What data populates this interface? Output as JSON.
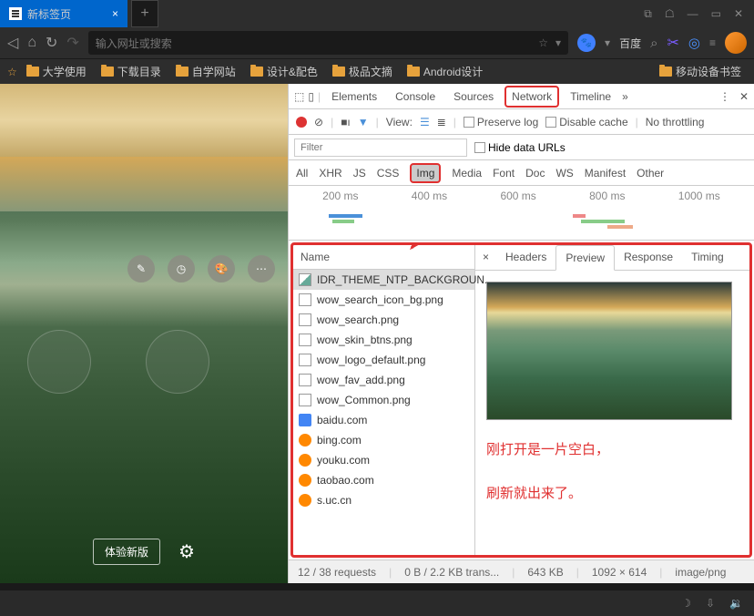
{
  "titlebar": {
    "tab_title": "新标签页",
    "newtab": "+"
  },
  "nav": {
    "placeholder": "输入网址或搜索",
    "search_engine": "百度"
  },
  "bookmarks": {
    "items": [
      "大学使用",
      "下载目录",
      "自学网站",
      "设计&配色",
      "极品文摘",
      "Android设计"
    ],
    "mobile": "移动设备书签"
  },
  "left_panel": {
    "experience": "体验新版"
  },
  "devtools": {
    "tabs": [
      "Elements",
      "Console",
      "Sources",
      "Network",
      "Timeline"
    ],
    "toolbar": {
      "view": "View:",
      "preserve": "Preserve log",
      "disable_cache": "Disable cache",
      "throttle": "No throttling"
    },
    "filter_placeholder": "Filter",
    "hide_urls": "Hide data URLs",
    "types": [
      "All",
      "XHR",
      "JS",
      "CSS",
      "Img",
      "Media",
      "Font",
      "Doc",
      "WS",
      "Manifest",
      "Other"
    ],
    "timeline_labels": [
      "200 ms",
      "400 ms",
      "600 ms",
      "800 ms",
      "1000 ms"
    ],
    "name_header": "Name",
    "requests": [
      {
        "name": "IDR_THEME_NTP_BACKGROUN...",
        "icon": "img",
        "sel": true
      },
      {
        "name": "wow_search_icon_bg.png",
        "icon": "box"
      },
      {
        "name": "wow_search.png",
        "icon": "box"
      },
      {
        "name": "wow_skin_btns.png",
        "icon": "box"
      },
      {
        "name": "wow_logo_default.png",
        "icon": "box"
      },
      {
        "name": "wow_fav_add.png",
        "icon": "box"
      },
      {
        "name": "wow_Common.png",
        "icon": "box"
      },
      {
        "name": "baidu.com",
        "icon": "blue"
      },
      {
        "name": "bing.com",
        "icon": "orange"
      },
      {
        "name": "youku.com",
        "icon": "orange"
      },
      {
        "name": "taobao.com",
        "icon": "orange"
      },
      {
        "name": "s.uc.cn",
        "icon": "orange"
      }
    ],
    "preview_tabs": [
      "Headers",
      "Preview",
      "Response",
      "Timing"
    ],
    "annotation1": "刚打开是一片空白，",
    "annotation2": "刷新就出来了。",
    "status": {
      "requests": "12 / 38 requests",
      "transfer": "0 B / 2.2 KB trans...",
      "size": "643 KB",
      "dims": "1092 × 614",
      "type": "image/png"
    }
  }
}
